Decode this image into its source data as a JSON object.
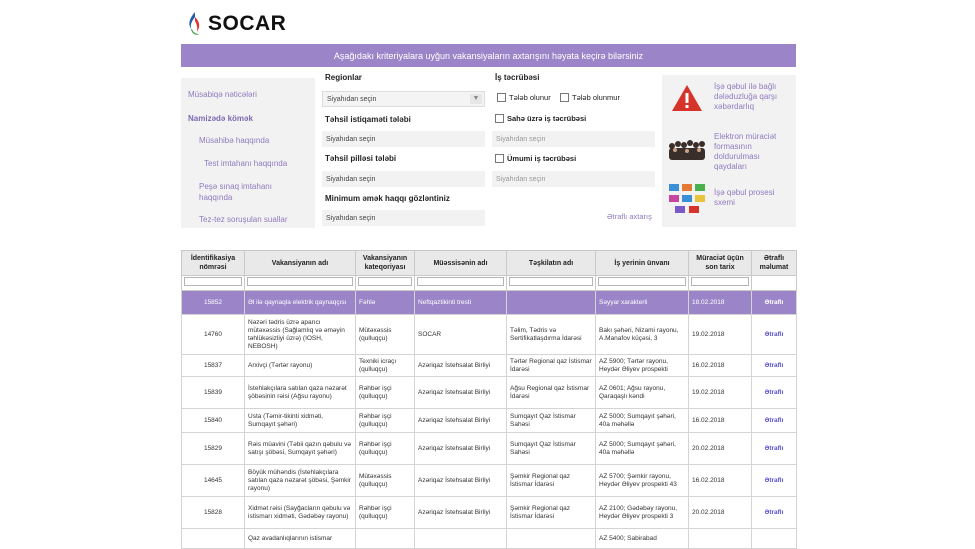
{
  "header": {
    "logo_text": "SOCAR"
  },
  "banner": "Aşağıdakı kriteriyalara uyğun vakansiyaların axtarışını həyata keçirə bilərsiniz",
  "left_nav": [
    "Müsabiqə nəticələri",
    "Namizədə kömək",
    "Müsahibə haqqında",
    "Test imtahanı haqqında",
    "Peşə sınaq imtahanı haqqında",
    "Tez-tez soruşulan suallar"
  ],
  "filters": {
    "regions_label": "Regionlar",
    "regions_value": "Siyahıdan seçin",
    "education_field_label": "Təhsil istiqaməti tələbi",
    "education_field_value": "Siyahıdan seçin",
    "education_level_label": "Təhsil pilləsi tələbi",
    "education_level_value": "Siyahıdan seçin",
    "min_salary_label": "Minimum əmək haqqı gözləntiniz",
    "min_salary_value": "Siyahıdan seçin",
    "experience_label": "İş təcrübəsi",
    "required_label": "Tələb olunur",
    "not_required_label": "Tələb olunmur",
    "field_experience_label": "Sahə üzrə iş təcrübəsi",
    "field_experience_value": "Siyahıdan seçin",
    "general_experience_label": "Ümumi iş təcrübəsi",
    "general_experience_value": "Siyahıdan seçin",
    "more_link": "Ətraflı axtarış"
  },
  "right_panel": [
    {
      "icon": "warning-icon",
      "text": "İşə qəbul ilə bağlı dələduzluğa qarşı xəbərdarlıq"
    },
    {
      "icon": "people-photo-icon",
      "text": "Elektron müraciət formasının doldurulması qaydaları"
    },
    {
      "icon": "process-diagram-icon",
      "text": "İşə qəbul prosesi sxemi"
    }
  ],
  "table": {
    "headers": [
      "İdentifikasiya nömrəsi",
      "Vakansiyanın adı",
      "Vakansiyanın kateqoriyası",
      "Müəssisənin adı",
      "Təşkilatın adı",
      "İş yerinin ünvanı",
      "Müraciət üçün son tarix",
      "Ətraflı məlumat"
    ],
    "rows": [
      [
        "15852",
        "Əl ilə qaynaqla elektrik qaynaqçısı",
        "Fəhlə",
        "Neftqaztikinti tresti",
        "",
        "Səyyar xarakterli",
        "18.02.2018",
        "Ətraflı"
      ],
      [
        "14760",
        "Nəzəri tədris üzrə aparıcı mütəxəssis (Sağlamlıq və əməyin təhlükəsizliyi üzrə) (IOSH, NEBOSH)",
        "Mütəxəssis (qulluqçu)",
        "SOCAR",
        "Təlim, Tədris və Sertifikatlaşdırma İdarəsi",
        "Bakı şəhəri, Nizami rayonu, A.Manafov küçəsi, 3",
        "19.02.2018",
        "Ətraflı"
      ],
      [
        "15837",
        "Arxivçi (Tərtər rayonu)",
        "Texniki icraçı (qulluqçu)",
        "Azəriqaz İstehsalat Birliyi",
        "Tərtər Regional qaz İstismar İdarəsi",
        "AZ 5900; Tərtər rayonu, Heydər Əliyev prospekti",
        "16.02.2018",
        "Ətraflı"
      ],
      [
        "15839",
        "İstehlakçılara satılan qaza nəzarət şöbəsinin rəisi (Ağsu rayonu)",
        "Rəhbər işçi (qulluqçu)",
        "Azəriqaz İstehsalat Birliyi",
        "Ağsu Regional qaz İstismar İdarəsi",
        "AZ 0601; Ağsu rayonu, Qaraqaşlı kəndi",
        "19.02.2018",
        "Ətraflı"
      ],
      [
        "15840",
        "Usta (Təmir-tikinti xidməti, Sumqayıt şəhəri)",
        "Rəhbər işçi (qulluqçu)",
        "Azəriqaz İstehsalat Birliyi",
        "Sumqayıt Qaz İstismar Sahəsi",
        "AZ 5000; Sumqayıt şəhəri, 40a məhəllə",
        "16.02.2018",
        "Ətraflı"
      ],
      [
        "15829",
        "Rəis müavini (Təbii qazın qəbulu və satışı şöbəsi, Sumqayıt şəhəri)",
        "Rəhbər işçi (qulluqçu)",
        "Azəriqaz İstehsalat Birliyi",
        "Sumqayıt Qaz İstismar Sahəsi",
        "AZ 5000; Sumqayıt şəhəri, 40a məhəllə",
        "20.02.2018",
        "Ətraflı"
      ],
      [
        "14645",
        "Böyük mühəndis (İstehlakçılara satılan qaza nəzarət şöbəsi, Şəmkir rayonu)",
        "Mütəxəssis (qulluqçu)",
        "Azəriqaz İstehsalat Birliyi",
        "Şəmkir Regional qaz İstismar İdarəsi",
        "AZ 5700; Şəmkir rayonu, Heydər Əliyev prospekti 43",
        "16.02.2018",
        "Ətraflı"
      ],
      [
        "15828",
        "Xidmət rəisi (Sayğacların qəbulu və istismarı xidməti, Gədəbəy rayonu)",
        "Rəhbər işçi (qulluqçu)",
        "Azəriqaz İstehsalat Birliyi",
        "Şəmkir Regional qaz İstismar İdarəsi",
        "AZ 2100; Gədəbəy rayonu, Heydər Əliyev prospekti 3",
        "20.02.2018",
        "Ətraflı"
      ],
      [
        "",
        "Qaz avadanlıqlarının istismar",
        "",
        "",
        "",
        "AZ 5400; Sabirabad",
        "",
        ""
      ]
    ]
  },
  "colors": {
    "accent": "#9b85c8",
    "link": "#8f7bbf"
  }
}
